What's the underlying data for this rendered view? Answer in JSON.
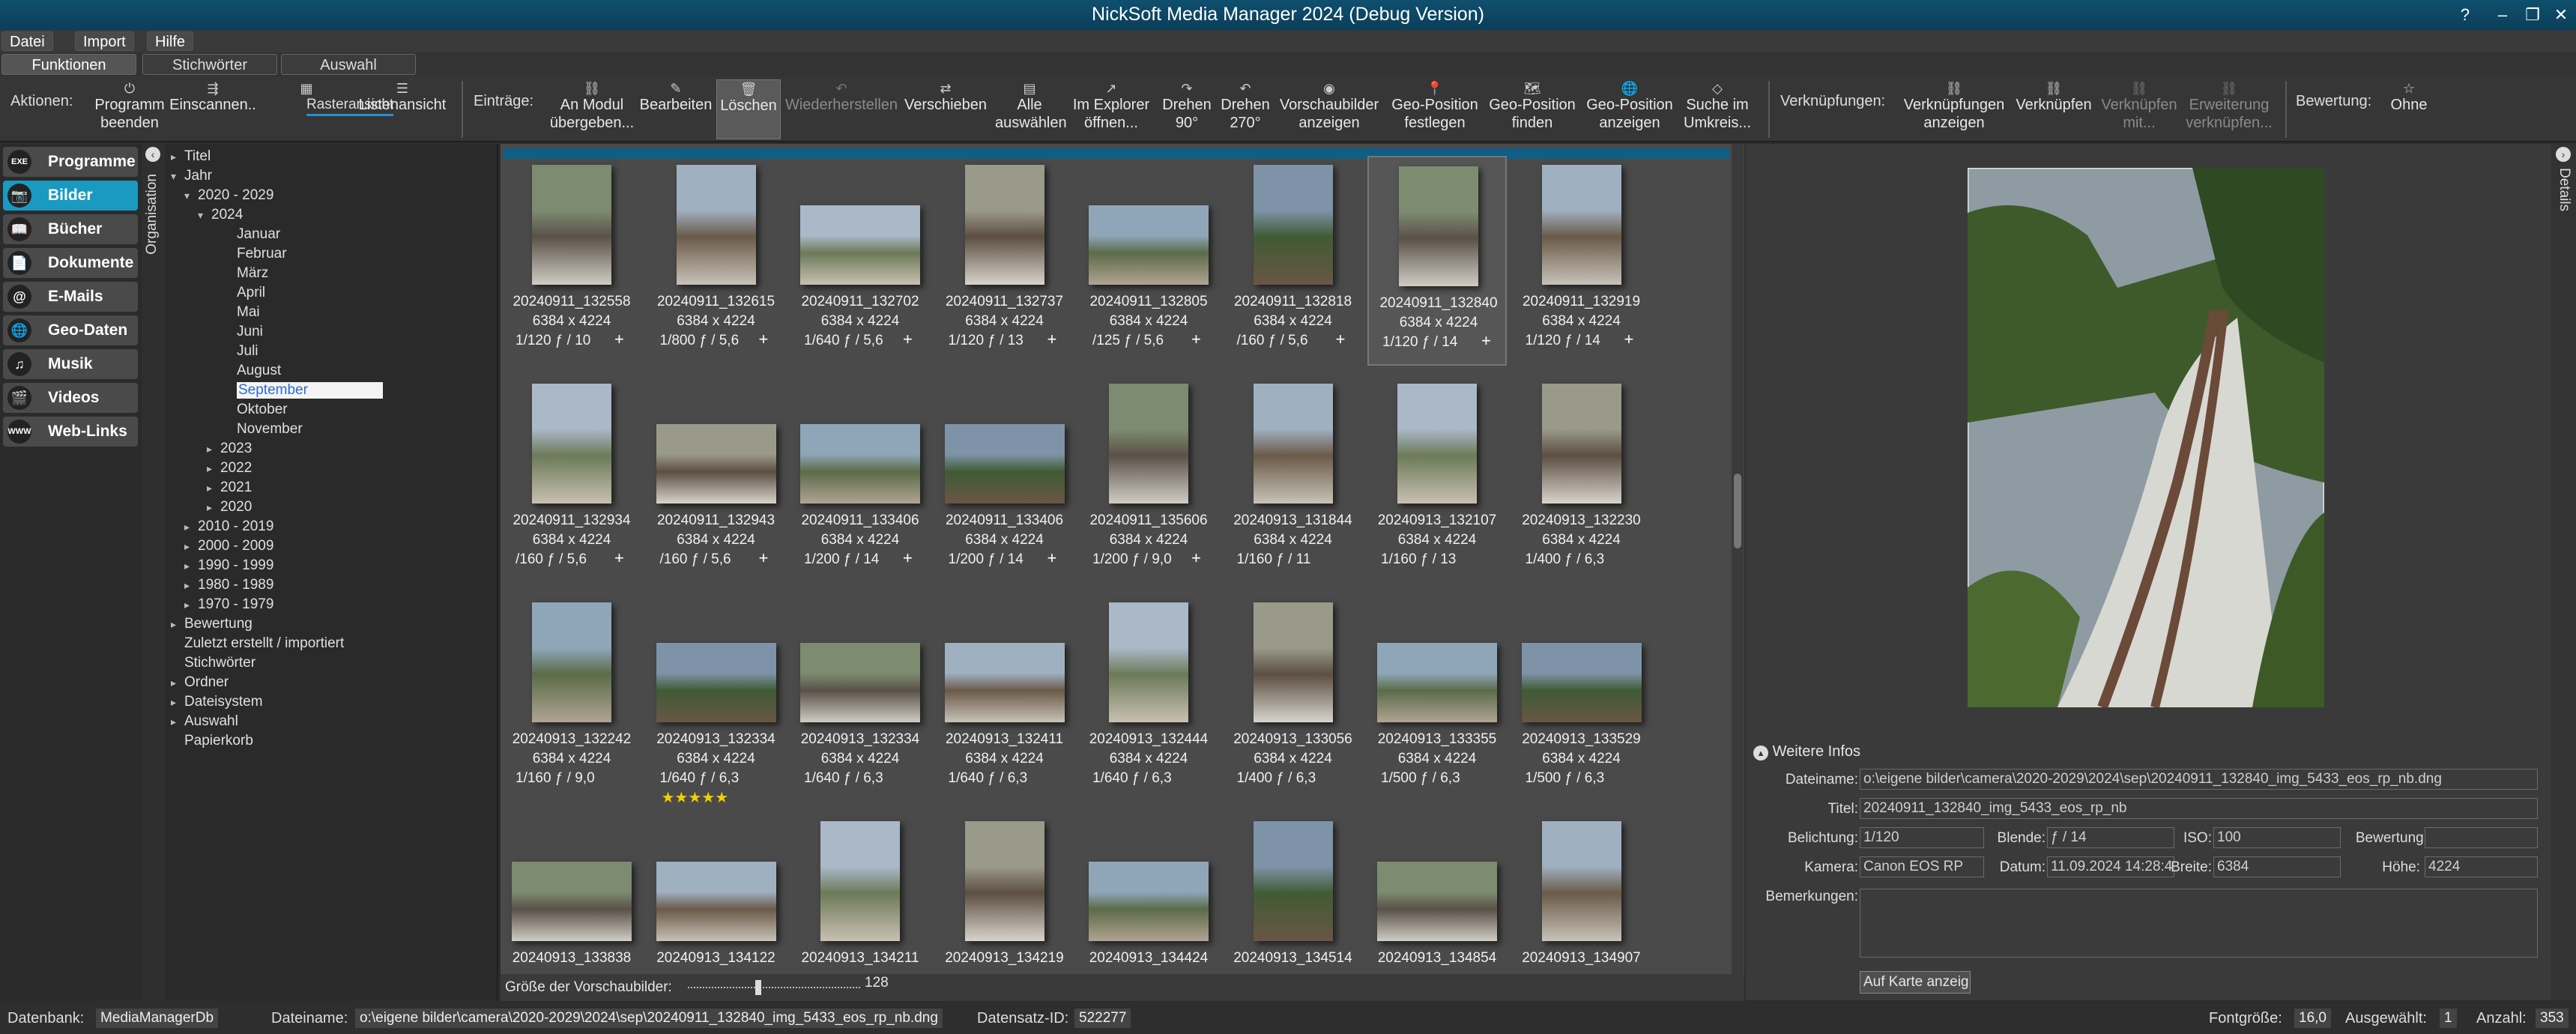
{
  "window": {
    "title": "NickSoft Media Manager 2024 (Debug Version)",
    "help": "?",
    "minimize": "–",
    "restore": "❐",
    "close": "✕"
  },
  "menu": [
    "Datei",
    "Import",
    "Hilfe"
  ],
  "tabs": [
    "Funktionen",
    "Stichwörter",
    "Auswahl"
  ],
  "ribbon": {
    "aktionen_label": "Aktionen:",
    "aktionen": [
      {
        "icon": "⏻",
        "l1": "Programm",
        "l2": "beenden"
      },
      {
        "icon": "⇶",
        "l1": "Einscannen..",
        "l2": ""
      },
      {
        "icon": "▦",
        "l1": "Rasteransicht",
        "l2": ""
      },
      {
        "icon": "☰",
        "l1": "Listenansicht",
        "l2": ""
      }
    ],
    "eintraege_label": "Einträge:",
    "eintraege": [
      {
        "icon": "⛓",
        "l1": "An Modul",
        "l2": "übergeben..."
      },
      {
        "icon": "✎",
        "l1": "Bearbeiten",
        "l2": ""
      },
      {
        "icon": "🗑",
        "l1": "Löschen",
        "l2": ""
      },
      {
        "icon": "↶",
        "l1": "Wiederherstellen",
        "l2": ""
      },
      {
        "icon": "⇄",
        "l1": "Verschieben",
        "l2": ""
      },
      {
        "icon": "▤",
        "l1": "Alle",
        "l2": "auswählen"
      },
      {
        "icon": "↗",
        "l1": "Im Explorer",
        "l2": "öffnen..."
      },
      {
        "icon": "↷",
        "l1": "Drehen",
        "l2": "90°"
      },
      {
        "icon": "↶",
        "l1": "Drehen",
        "l2": "270°"
      },
      {
        "icon": "◉",
        "l1": "Vorschaubilder",
        "l2": "anzeigen"
      },
      {
        "icon": "📍",
        "l1": "Geo-Position",
        "l2": "festlegen"
      },
      {
        "icon": "🗺",
        "l1": "Geo-Position",
        "l2": "finden"
      },
      {
        "icon": "🌐",
        "l1": "Geo-Position",
        "l2": "anzeigen"
      },
      {
        "icon": "◇",
        "l1": "Suche im",
        "l2": "Umkreis..."
      }
    ],
    "verkn_label": "Verknüpfungen:",
    "verkn": [
      {
        "icon": "⛓",
        "l1": "Verknüpfungen",
        "l2": "anzeigen"
      },
      {
        "icon": "⛓",
        "l1": "Verknüpfen",
        "l2": ""
      },
      {
        "icon": "⛓",
        "l1": "Verknüpfen",
        "l2": "mit..."
      },
      {
        "icon": "⛓",
        "l1": "Erweiterung",
        "l2": "verknüpfen..."
      }
    ],
    "bewertung_label": "Bewertung:",
    "bewertung": {
      "icon": "☆",
      "l1": "Ohne"
    }
  },
  "nav": [
    {
      "icon": "EXE",
      "label": "Programme"
    },
    {
      "icon": "📷",
      "label": "Bilder"
    },
    {
      "icon": "📖",
      "label": "Bücher"
    },
    {
      "icon": "📄",
      "label": "Dokumente"
    },
    {
      "icon": "@",
      "label": "E-Mails"
    },
    {
      "icon": "🌐",
      "label": "Geo-Daten"
    },
    {
      "icon": "♫",
      "label": "Musik"
    },
    {
      "icon": "🎬",
      "label": "Videos"
    },
    {
      "icon": "WWW",
      "label": "Web-Links"
    }
  ],
  "org_label": "Organisation",
  "details_label": "Details",
  "tree": [
    "Titel",
    "Jahr",
    "2020 - 2029",
    "2024",
    "Januar",
    "Februar",
    "März",
    "April",
    "Mai",
    "Juni",
    "Juli",
    "August",
    "September",
    "Oktober",
    "November",
    "2023",
    "2022",
    "2021",
    "2020",
    "2010 - 2019",
    "2000 - 2009",
    "1990 - 1999",
    "1980 - 1989",
    "1970 - 1979",
    "Bewertung",
    "Zuletzt erstellt / importiert",
    "Stichwörter",
    "Ordner",
    "Dateisystem",
    "Auswahl",
    "Papierkorb"
  ],
  "thumbs": [
    {
      "name": "20240911_132558",
      "dim": "6384 x 4224",
      "exp": "1/120  ƒ / 10",
      "plus": "+",
      "stars": ""
    },
    {
      "name": "20240911_132615",
      "dim": "6384 x 4224",
      "exp": "1/800  ƒ / 5,6",
      "plus": "+",
      "stars": ""
    },
    {
      "name": "20240911_132702",
      "dim": "6384 x 4224",
      "exp": "1/640  ƒ / 5,6",
      "plus": "+",
      "stars": ""
    },
    {
      "name": "20240911_132737",
      "dim": "6384 x 4224",
      "exp": "1/120  ƒ / 13",
      "plus": "+",
      "stars": ""
    },
    {
      "name": "20240911_132805",
      "dim": "6384 x 4224",
      "exp": "/125  ƒ / 5,6",
      "plus": "+",
      "stars": ""
    },
    {
      "name": "20240911_132818",
      "dim": "6384 x 4224",
      "exp": "/160  ƒ / 5,6",
      "plus": "+",
      "stars": ""
    },
    {
      "name": "20240911_132840",
      "dim": "6384 x 4224",
      "exp": "1/120  ƒ / 14",
      "plus": "+",
      "stars": ""
    },
    {
      "name": "20240911_132919",
      "dim": "6384 x 4224",
      "exp": "1/120  ƒ / 14",
      "plus": "+",
      "stars": ""
    },
    {
      "name": "20240911_132934",
      "dim": "6384 x 4224",
      "exp": "/160  ƒ / 5,6",
      "plus": "+",
      "stars": ""
    },
    {
      "name": "20240911_132943",
      "dim": "6384 x 4224",
      "exp": "/160  ƒ / 5,6",
      "plus": "+",
      "stars": ""
    },
    {
      "name": "20240911_133406",
      "dim": "6384 x 4224",
      "exp": "1/200  ƒ / 14",
      "plus": "+",
      "stars": ""
    },
    {
      "name": "20240911_133406",
      "dim": "6384 x 4224",
      "exp": "1/200  ƒ / 14",
      "plus": "+",
      "stars": ""
    },
    {
      "name": "20240911_135606",
      "dim": "6384 x 4224",
      "exp": "1/200  ƒ / 9,0",
      "plus": "+",
      "stars": ""
    },
    {
      "name": "20240913_131844",
      "dim": "6384 x 4224",
      "exp": "1/160  ƒ / 11",
      "plus": "",
      "stars": ""
    },
    {
      "name": "20240913_132107",
      "dim": "6384 x 4224",
      "exp": "1/160  ƒ / 13",
      "plus": "",
      "stars": ""
    },
    {
      "name": "20240913_132230",
      "dim": "6384 x 4224",
      "exp": "1/400  ƒ / 6,3",
      "plus": "",
      "stars": ""
    },
    {
      "name": "20240913_132242",
      "dim": "6384 x 4224",
      "exp": "1/160  ƒ / 9,0",
      "plus": "",
      "stars": ""
    },
    {
      "name": "20240913_132334",
      "dim": "6384 x 4224",
      "exp": "1/640  ƒ / 6,3",
      "plus": "",
      "stars": "★★★★★"
    },
    {
      "name": "20240913_132334",
      "dim": "6384 x 4224",
      "exp": "1/640  ƒ / 6,3",
      "plus": "",
      "stars": ""
    },
    {
      "name": "20240913_132411",
      "dim": "6384 x 4224",
      "exp": "1/640  ƒ / 6,3",
      "plus": "",
      "stars": ""
    },
    {
      "name": "20240913_132444",
      "dim": "6384 x 4224",
      "exp": "1/640  ƒ / 6,3",
      "plus": "",
      "stars": ""
    },
    {
      "name": "20240913_133056",
      "dim": "6384 x 4224",
      "exp": "1/400  ƒ / 6,3",
      "plus": "",
      "stars": ""
    },
    {
      "name": "20240913_133355",
      "dim": "6384 x 4224",
      "exp": "1/500  ƒ / 6,3",
      "plus": "",
      "stars": ""
    },
    {
      "name": "20240913_133529",
      "dim": "6384 x 4224",
      "exp": "1/500  ƒ / 6,3",
      "plus": "",
      "stars": ""
    },
    {
      "name": "20240913_133838",
      "dim": "",
      "exp": "",
      "plus": "",
      "stars": ""
    },
    {
      "name": "20240913_134122",
      "dim": "",
      "exp": "",
      "plus": "",
      "stars": ""
    },
    {
      "name": "20240913_134211",
      "dim": "",
      "exp": "",
      "plus": "",
      "stars": ""
    },
    {
      "name": "20240913_134219",
      "dim": "",
      "exp": "",
      "plus": "",
      "stars": ""
    },
    {
      "name": "20240913_134424",
      "dim": "",
      "exp": "",
      "plus": "",
      "stars": ""
    },
    {
      "name": "20240913_134514",
      "dim": "",
      "exp": "",
      "plus": "",
      "stars": ""
    },
    {
      "name": "20240913_134854",
      "dim": "",
      "exp": "",
      "plus": "",
      "stars": ""
    },
    {
      "name": "20240913_134907",
      "dim": "",
      "exp": "",
      "plus": "",
      "stars": ""
    }
  ],
  "sizebar": {
    "label": "Größe der Vorschaubilder:",
    "value": "128"
  },
  "info": {
    "header": "Weitere Infos",
    "dateiname_label": "Dateiname:",
    "dateiname": "o:\\eigene bilder\\camera\\2020-2029\\2024\\sep\\20240911_132840_img_5433_eos_rp_nb.dng",
    "titel_label": "Titel:",
    "titel": "20240911_132840_img_5433_eos_rp_nb",
    "belichtung_label": "Belichtung:",
    "belichtung": "1/120",
    "blende_label": "Blende:",
    "blende": "ƒ / 14",
    "iso_label": "ISO:",
    "iso": "100",
    "bewertung_label": "Bewertung:",
    "bewertung": "",
    "kamera_label": "Kamera:",
    "kamera": "Canon EOS RP",
    "datum_label": "Datum:",
    "datum": "11.09.2024 14:28:4",
    "breite_label": "Breite:",
    "breite": "6384",
    "hoehe_label": "Höhe:",
    "hoehe": "4224",
    "bemerkungen_label": "Bemerkungen:",
    "bemerkungen": "",
    "karte_button": "Auf Karte anzeig"
  },
  "status": {
    "datenbank_label": "Datenbank:",
    "datenbank": "MediaManagerDb",
    "dateiname_label": "Dateiname:",
    "dateiname": "o:\\eigene bilder\\camera\\2020-2029\\2024\\sep\\20240911_132840_img_5433_eos_rp_nb.dng",
    "datensatz_label": "Datensatz-ID:",
    "datensatz": "522277",
    "fontgroesse_label": "Fontgröße:",
    "fontgroesse": "16,0",
    "ausgewaehlt_label": "Ausgewählt:",
    "ausgewaehlt": "1",
    "anzahl_label": "Anzahl:",
    "anzahl": "353"
  }
}
